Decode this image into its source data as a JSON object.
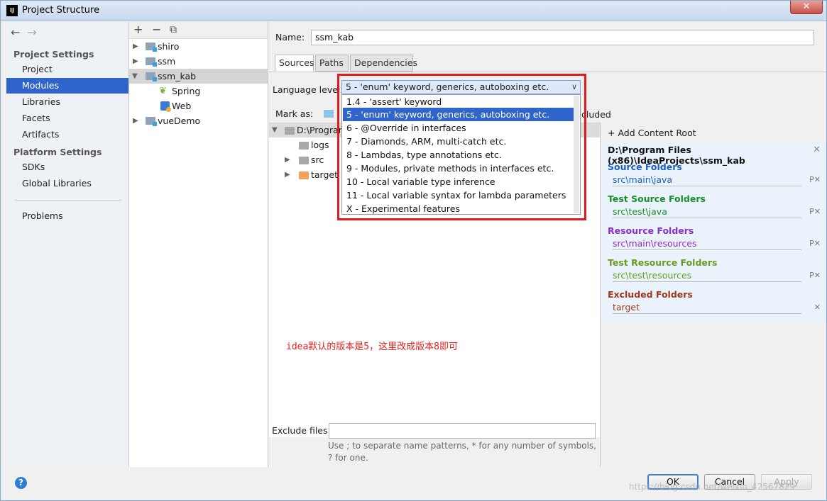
{
  "window": {
    "title": "Project Structure",
    "logo": "IJ",
    "close_label": "✕"
  },
  "nav": {
    "back_icon": "←",
    "forward_icon": "→",
    "section_project_settings": "Project Settings",
    "items_project": [
      "Project",
      "Modules",
      "Libraries",
      "Facets",
      "Artifacts"
    ],
    "section_platform_settings": "Platform Settings",
    "items_platform": [
      "SDKs",
      "Global Libraries"
    ],
    "problems": "Problems",
    "selected": "Modules"
  },
  "modules_toolbar": {
    "add": "+",
    "remove": "−",
    "copy": "⧉"
  },
  "modules_tree": {
    "shiro": "shiro",
    "ssm": "ssm",
    "ssm_kab": "ssm_kab",
    "spring": "Spring",
    "web": "Web",
    "vueDemo": "vueDemo"
  },
  "main": {
    "name_label": "Name:",
    "name_value": "ssm_kab",
    "tabs": [
      "Sources",
      "Paths",
      "Dependencies"
    ],
    "active_tab": "Sources",
    "language_level_label": "Language level:",
    "mark_as_label": "Mark as:",
    "mark_as_tail": "cluded",
    "root_folder": "D:\\Program",
    "children": [
      "logs",
      "src",
      "target"
    ],
    "annotation": "idea默认的版本是5，这里改成版本8即可",
    "exclude_files_label": "Exclude files:",
    "exclude_hint": "Use ; to separate name patterns, * for any number of symbols, ? for one."
  },
  "language_dropdown": {
    "selected_value": "5 - 'enum' keyword, generics, autoboxing etc.",
    "options": [
      "1.4 - 'assert' keyword",
      "5 - 'enum' keyword, generics, autoboxing etc.",
      "6 - @Override in interfaces",
      "7 - Diamonds, ARM, multi-catch etc.",
      "8 - Lambdas, type annotations etc.",
      "9 - Modules, private methods in interfaces etc.",
      "10 - Local variable type inference",
      "11 - Local variable syntax for lambda parameters",
      "X - Experimental features"
    ]
  },
  "roots": {
    "add_content_root": "Add Content Root",
    "root_path": "D:\\Program Files (x86)\\IdeaProjects\\ssm_kab",
    "source_folders": {
      "heading": "Source Folders",
      "entry": "src\\main\\java",
      "color": "#1f5fbf"
    },
    "test_source_folders": {
      "heading": "Test Source Folders",
      "entry": "src\\test\\java",
      "color": "#1a8f2a"
    },
    "resource_folders": {
      "heading": "Resource Folders",
      "entry": "src\\main\\resources",
      "color": "#8a2fc7"
    },
    "test_resource_folders": {
      "heading": "Test Resource Folders",
      "entry": "src\\test\\resources",
      "color": "#6a9a1f"
    },
    "excluded_folders": {
      "heading": "Excluded Folders",
      "entry": "target",
      "color": "#a0381a"
    }
  },
  "footer": {
    "help": "?",
    "ok": "OK",
    "cancel": "Cancel",
    "apply": "Apply",
    "watermark": "https://blog.csdn.net/weixin_42567829"
  }
}
